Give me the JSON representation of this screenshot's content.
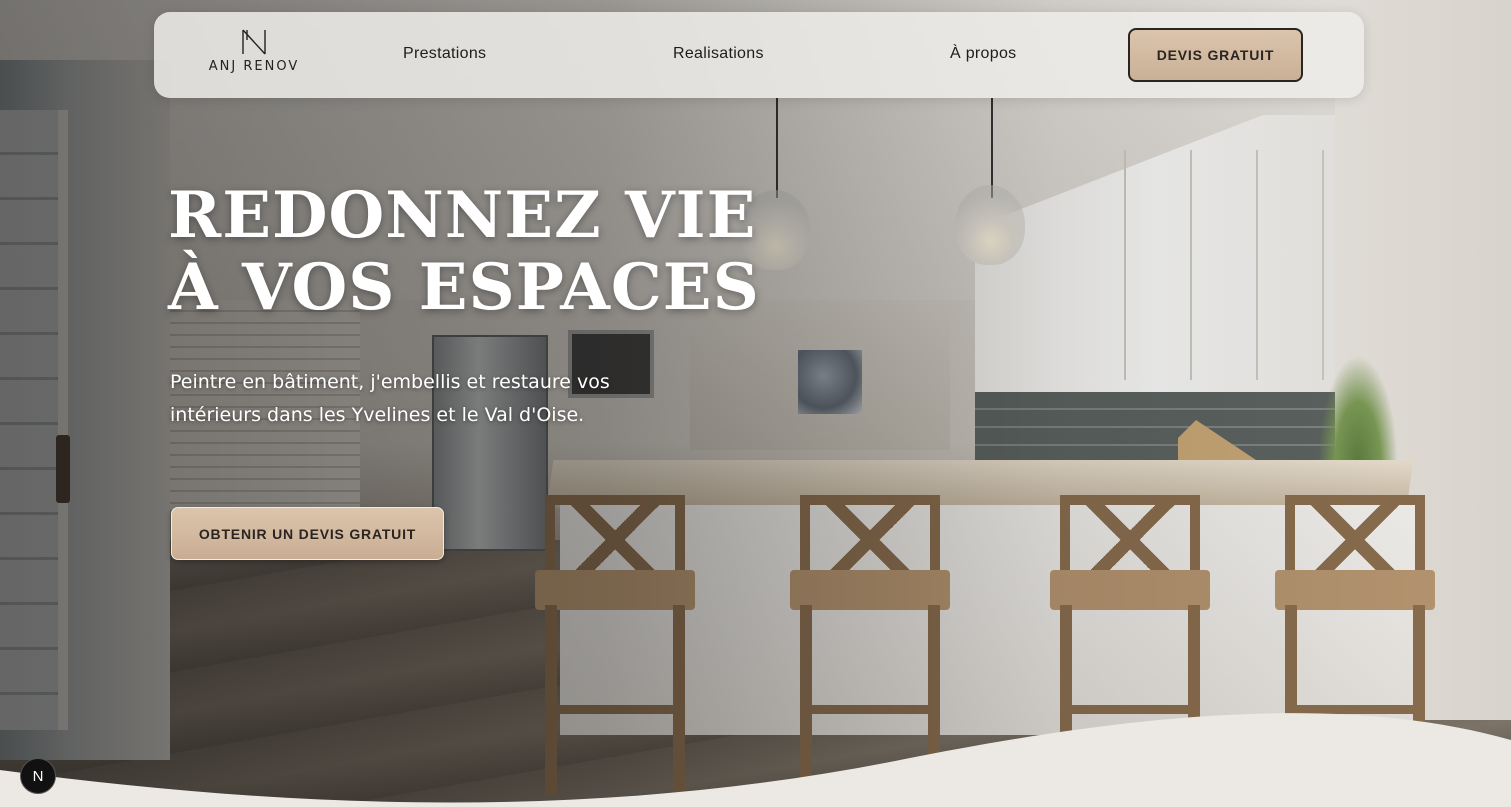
{
  "brand": {
    "logo_letter": "N",
    "name": "ANJ RENOV"
  },
  "nav": {
    "links": [
      {
        "label": "Prestations"
      },
      {
        "label": "Realisations"
      },
      {
        "label": "À propos"
      }
    ],
    "cta_label": "DEVIS GRATUIT"
  },
  "hero": {
    "title_line1": "REDONNEZ VIE",
    "title_line2": "À VOS ESPACES",
    "subtitle": "Peintre en bâtiment, j'embellis et restaure vos intérieurs dans les Yvelines et le Val d'Oise.",
    "cta_label": "OBTENIR UN DEVIS GRATUIT"
  },
  "badge": {
    "label": "N"
  },
  "colors": {
    "accent": "#d4bca3",
    "nav_bg": "#eeece9",
    "text_dark": "#2a2520",
    "page_bg": "#ece8e4"
  }
}
